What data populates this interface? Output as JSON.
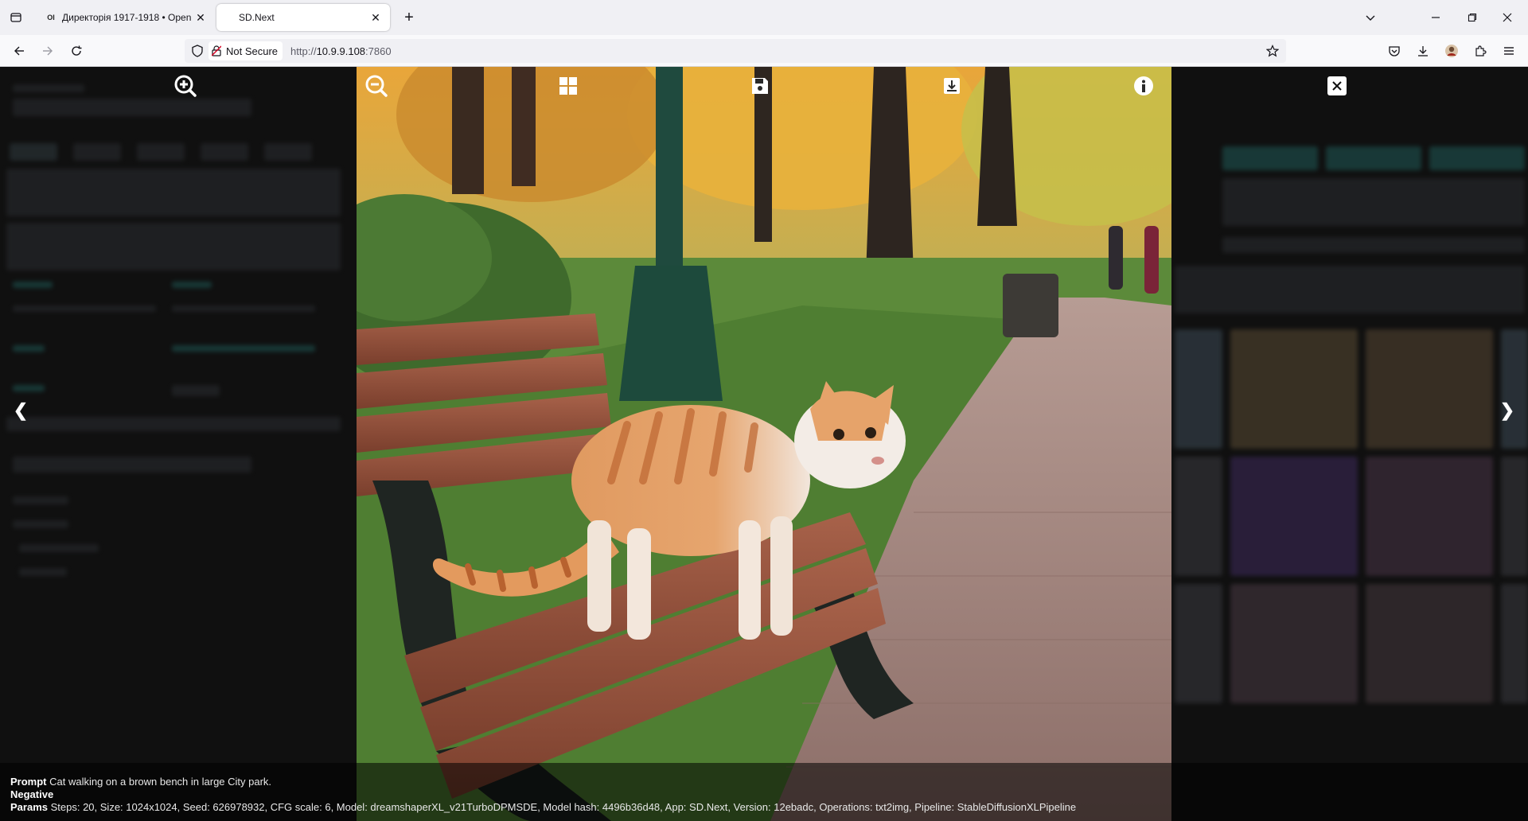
{
  "browser": {
    "tabs": [
      {
        "title": "Директорія 1917-1918 • Open",
        "favicon": "OI",
        "active": false
      },
      {
        "title": "SD.Next",
        "active": true
      }
    ],
    "url_prefix": "http://",
    "url_host": "10.9.9.108",
    "url_port": ":7860",
    "security_label": "Not Secure"
  },
  "modal": {
    "toolbar_icons": [
      "zoom-in-icon",
      "zoom-out-icon",
      "grid-icon",
      "save-icon",
      "download-icon",
      "info-icon",
      "close-icon"
    ],
    "prev_arrow": "❮",
    "next_arrow": "❯",
    "image_subject": "orange-and-white cat on park bench"
  },
  "info": {
    "prompt_label": "Prompt",
    "prompt_value": "Cat walking on a brown bench in large City park.",
    "negative_label": "Negative",
    "negative_value": "",
    "params_label": "Params",
    "params_value": "Steps: 20, Size: 1024x1024, Seed: 626978932, CFG scale: 6, Model: dreamshaperXL_v21TurboDPMSDE, Model hash: 4496b36d48, App: SD.Next, Version: 12ebadc, Operations: txt2img, Pipeline: StableDiffusionXLPipeline"
  }
}
